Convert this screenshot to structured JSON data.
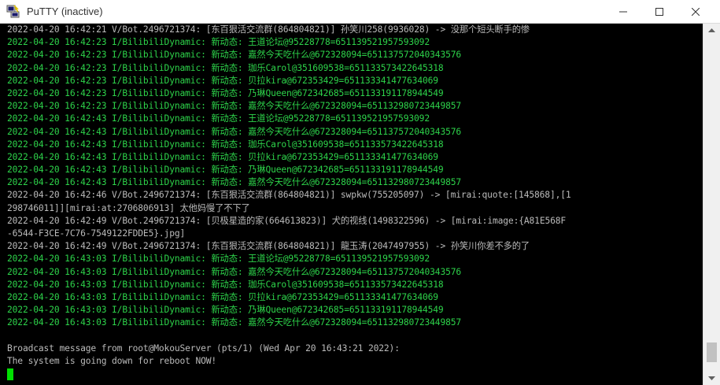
{
  "window": {
    "title": "PuTTY (inactive)",
    "icon": "putty-icon"
  },
  "scrollbar": {
    "position_fraction": 0.97,
    "visible_fraction": 0.06
  },
  "terminal": {
    "colors": {
      "log": "#2dd34a",
      "system": "#bbbbbb",
      "background": "#000000",
      "cursor": "#00e000"
    },
    "lines": [
      {
        "text": "2022-04-20 16:42:21 V/Bot.2496721374: [东百狠活交流群(864804821)] 孙笑川258(9936028) -> 没那个短头断手的惨",
        "color": "gray"
      },
      {
        "text": "2022-04-20 16:42:23 I/BilibiliDynamic: 新动态: 王道论坛@95228778=651139521957593092",
        "color": "green"
      },
      {
        "text": "2022-04-20 16:42:23 I/BilibiliDynamic: 新动态: 嘉然今天吃什么@672328094=651137572040343576",
        "color": "green"
      },
      {
        "text": "2022-04-20 16:42:23 I/BilibiliDynamic: 新动态: 珈乐Carol@351609538=651133573422645318",
        "color": "green"
      },
      {
        "text": "2022-04-20 16:42:23 I/BilibiliDynamic: 新动态: 贝拉kira@672353429=651133341477634069",
        "color": "green"
      },
      {
        "text": "2022-04-20 16:42:23 I/BilibiliDynamic: 新动态: 乃琳Queen@672342685=651133191178944549",
        "color": "green"
      },
      {
        "text": "2022-04-20 16:42:23 I/BilibiliDynamic: 新动态: 嘉然今天吃什么@672328094=651132980723449857",
        "color": "green"
      },
      {
        "text": "2022-04-20 16:42:43 I/BilibiliDynamic: 新动态: 王道论坛@95228778=651139521957593092",
        "color": "green"
      },
      {
        "text": "2022-04-20 16:42:43 I/BilibiliDynamic: 新动态: 嘉然今天吃什么@672328094=651137572040343576",
        "color": "green"
      },
      {
        "text": "2022-04-20 16:42:43 I/BilibiliDynamic: 新动态: 珈乐Carol@351609538=651133573422645318",
        "color": "green"
      },
      {
        "text": "2022-04-20 16:42:43 I/BilibiliDynamic: 新动态: 贝拉kira@672353429=651133341477634069",
        "color": "green"
      },
      {
        "text": "2022-04-20 16:42:43 I/BilibiliDynamic: 新动态: 乃琳Queen@672342685=651133191178944549",
        "color": "green"
      },
      {
        "text": "2022-04-20 16:42:43 I/BilibiliDynamic: 新动态: 嘉然今天吃什么@672328094=651132980723449857",
        "color": "green"
      },
      {
        "text": "2022-04-20 16:42:46 V/Bot.2496721374: [东百狠活交流群(864804821)] swpkw(755205097) -> [mirai:quote:[145868],[1",
        "color": "gray"
      },
      {
        "text": "298746011]][mirai:at:2706806913] 太他妈慢了不下了",
        "color": "gray"
      },
      {
        "text": "2022-04-20 16:42:49 V/Bot.2496721374: [贝极星造的家(664613823)] 犬的视线(1498322596) -> [mirai:image:{A81E568F",
        "color": "gray"
      },
      {
        "text": "-6544-F3CE-7C76-7549122FDDE5}.jpg]",
        "color": "gray"
      },
      {
        "text": "2022-04-20 16:42:49 V/Bot.2496721374: [东百狠活交流群(864804821)] 龍玉涛(2047497955) -> 孙笑川你差不多的了",
        "color": "gray"
      },
      {
        "text": "2022-04-20 16:43:03 I/BilibiliDynamic: 新动态: 王道论坛@95228778=651139521957593092",
        "color": "green"
      },
      {
        "text": "2022-04-20 16:43:03 I/BilibiliDynamic: 新动态: 嘉然今天吃什么@672328094=651137572040343576",
        "color": "green"
      },
      {
        "text": "2022-04-20 16:43:03 I/BilibiliDynamic: 新动态: 珈乐Carol@351609538=651133573422645318",
        "color": "green"
      },
      {
        "text": "2022-04-20 16:43:03 I/BilibiliDynamic: 新动态: 贝拉kira@672353429=651133341477634069",
        "color": "green"
      },
      {
        "text": "2022-04-20 16:43:03 I/BilibiliDynamic: 新动态: 乃琳Queen@672342685=651133191178944549",
        "color": "green"
      },
      {
        "text": "2022-04-20 16:43:03 I/BilibiliDynamic: 新动态: 嘉然今天吃什么@672328094=651132980723449857",
        "color": "green"
      },
      {
        "text": "",
        "color": "gray"
      },
      {
        "text": "Broadcast message from root@MokouServer (pts/1) (Wed Apr 20 16:43:21 2022):",
        "color": "gray"
      },
      {
        "text": "The system is going down for reboot NOW!",
        "color": "gray"
      }
    ]
  }
}
